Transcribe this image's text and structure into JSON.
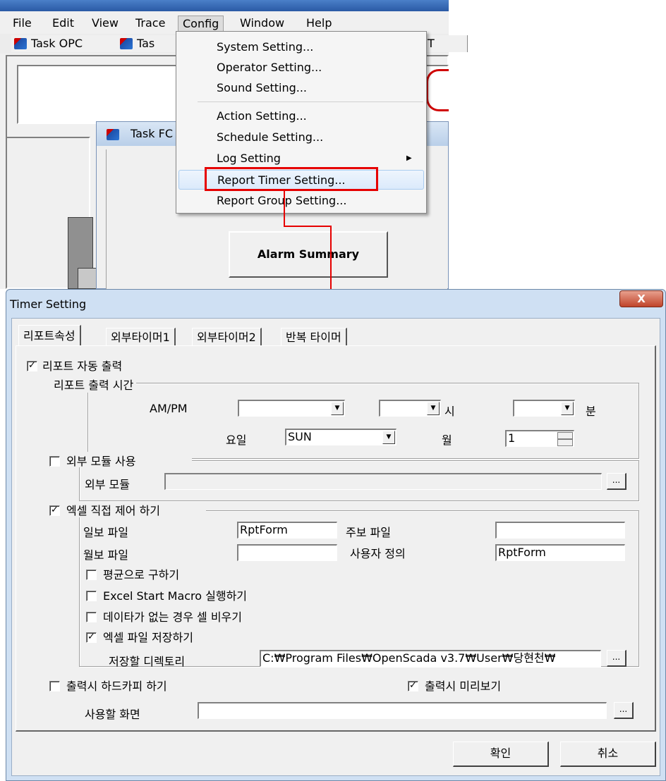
{
  "menubar": {
    "items": [
      "File",
      "Edit",
      "View",
      "Trace",
      "Config",
      "Window",
      "Help"
    ]
  },
  "tabs_strip": {
    "items": [
      "Task OPC",
      "Tas",
      "T"
    ]
  },
  "background_windows": {
    "child_title": "Task FC",
    "alarm_button": "Alarm Summary"
  },
  "config_menu": {
    "items": [
      "System Setting...",
      "Operator Setting...",
      "Sound Setting...",
      "Action Setting...",
      "Schedule Setting...",
      "Log Setting",
      "Report Timer Setting...",
      "Report Group Setting..."
    ],
    "highlighted_index": 6,
    "annotation_color": "#e60000"
  },
  "dialog": {
    "title": "Timer Setting",
    "close_label": "X",
    "tabs": [
      "리포트속성",
      "외부타이머1",
      "외부타이머2",
      "반복 타이머"
    ],
    "auto_output": {
      "label": "리포트 자동 출력",
      "checked": true
    },
    "output_time": {
      "legend": "리포트 출력 시간",
      "ampm_label": "AM/PM",
      "ampm_value": "",
      "hour_value": "",
      "hour_unit": "시",
      "minute_value": "",
      "minute_unit": "분",
      "weekday_label": "요일",
      "weekday_value": "SUN",
      "month_label": "월",
      "month_value": "1"
    },
    "external_module": {
      "legend": "외부 모듈 사용",
      "checked": false,
      "field_label": "외부 모듈",
      "field_value": "",
      "browse": "..."
    },
    "excel": {
      "legend": "엑셀 직접 제어 하기",
      "checked": true,
      "daily_label": "일보 파일",
      "daily_value": "RptForm",
      "weekly_label": "주보 파일",
      "weekly_value": "",
      "monthly_label": "월보 파일",
      "monthly_value": "",
      "custom_label": "사용자 정의",
      "custom_value": "RptForm",
      "avg": {
        "label": "평균으로 구하기",
        "checked": false
      },
      "macro": {
        "label": "Excel Start Macro 실행하기",
        "checked": false
      },
      "empty": {
        "label": "데이타가 없는 경우 셀 비우기",
        "checked": false
      },
      "save": {
        "label": "엑셀 파일 저장하기",
        "checked": true
      },
      "dir_label": "저장할 디렉토리",
      "dir_value": "C:₩Program Files₩OpenScada v3.7₩User₩당현천₩",
      "browse": "..."
    },
    "hardcopy": {
      "label": "출력시 하드카피 하기",
      "checked": false
    },
    "preview": {
      "label": "출력시 미리보기",
      "checked": true
    },
    "screen_label": "사용할 화면",
    "screen_value": "",
    "screen_browse": "...",
    "ok": "확인",
    "cancel": "취소"
  }
}
